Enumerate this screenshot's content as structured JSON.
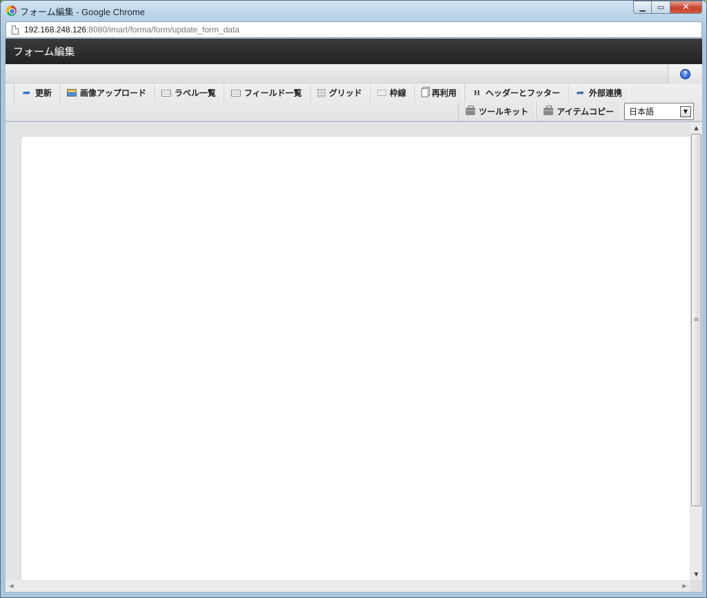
{
  "window": {
    "title": "フォーム編集 - Google Chrome",
    "minimize_glyph": "▁",
    "maximize_glyph": "▭",
    "close_glyph": "✕"
  },
  "address": {
    "host": "192.168.248.126",
    "rest": ":8080/imart/forma/form/update_form_data"
  },
  "app": {
    "title": "フォーム編集",
    "help_glyph": "?"
  },
  "toolbar": {
    "row1": [
      {
        "label": "更新",
        "icon": "update-icon"
      },
      {
        "label": "画像アップロード",
        "icon": "image-upload-icon"
      },
      {
        "label": "ラベル一覧",
        "icon": "label-list-icon"
      },
      {
        "label": "フィールド一覧",
        "icon": "field-list-icon"
      },
      {
        "label": "グリッド",
        "icon": "grid-icon"
      },
      {
        "label": "枠線",
        "icon": "frame-line-icon"
      },
      {
        "label": "再利用",
        "icon": "reuse-icon"
      },
      {
        "label": "ヘッダーとフッター",
        "icon": "header-footer-icon",
        "icon_glyph": "H"
      },
      {
        "label": "外部連携",
        "icon": "external-link-icon"
      }
    ],
    "row2": [
      {
        "label": "ツールキット",
        "icon": "toolkit-icon"
      },
      {
        "label": "アイテムコピー",
        "icon": "item-copy-icon"
      }
    ],
    "language": {
      "selected": "日本語",
      "arrow_glyph": "▼"
    }
  },
  "scrollbars": {
    "up_glyph": "▲",
    "down_glyph": "▼",
    "left_glyph": "◀",
    "right_glyph": "▶",
    "grip_glyph": "≡"
  }
}
